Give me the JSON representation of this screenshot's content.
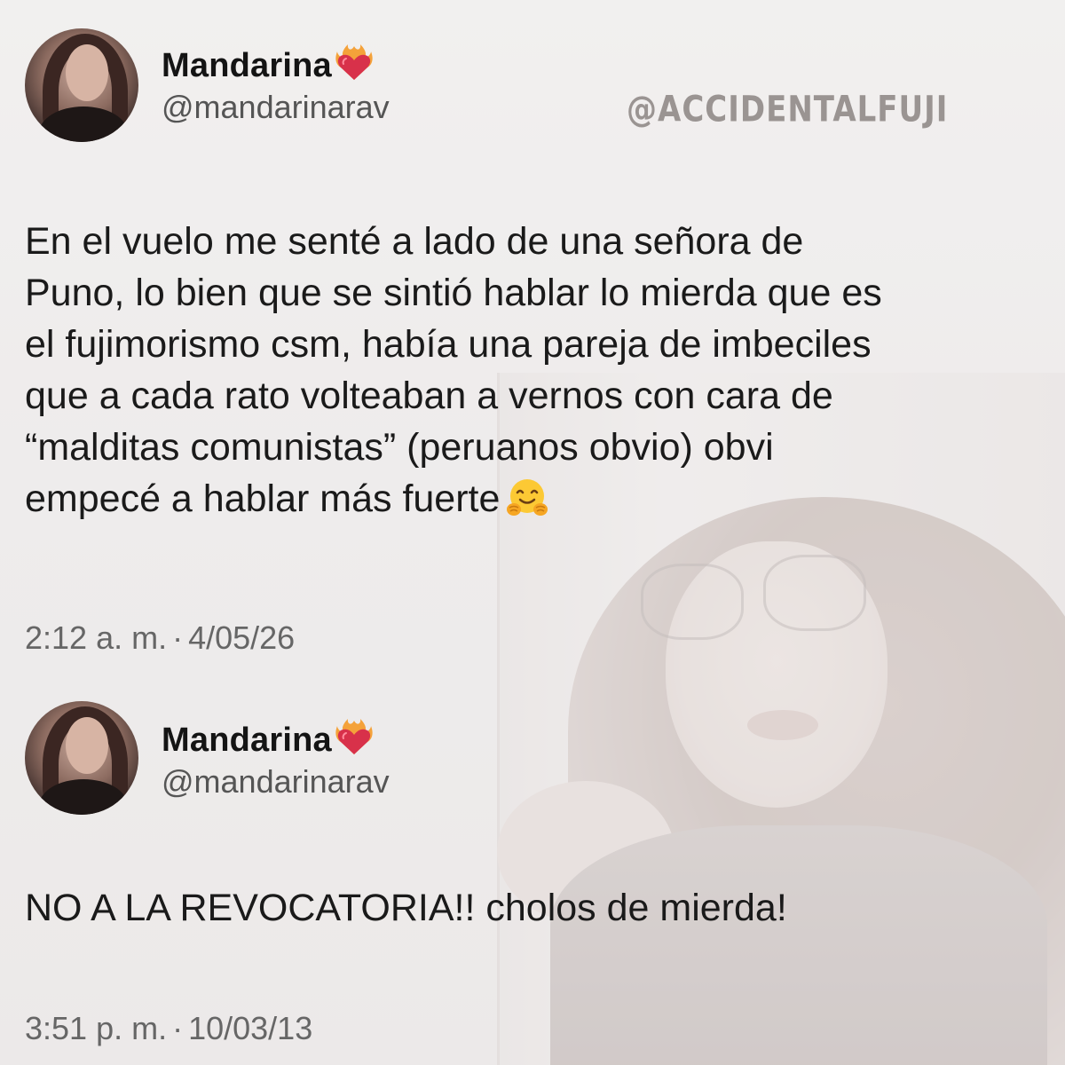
{
  "watermark": "@ACCIDENTALFUJI",
  "tweets": [
    {
      "author": {
        "display_name": "Mandarina",
        "name_emoji": "heart-on-fire-emoji",
        "handle": "@mandarinarav"
      },
      "text_lines": [
        "En el vuelo me senté a lado de una señora de",
        "Puno, lo bien que se sintió hablar lo mierda que es",
        "el fujimorismo csm, había una pareja de imbeciles",
        "que a cada rato volteaban a vernos con cara de",
        "“malditas comunistas” (peruanos obvio) obvi",
        "empecé a hablar más fuerte"
      ],
      "trailing_emoji": "hugging-face-emoji",
      "time": "2:12 a. m.",
      "separator": "·",
      "date": "4/05/26"
    },
    {
      "author": {
        "display_name": "Mandarina",
        "name_emoji": "heart-on-fire-emoji",
        "handle": "@mandarinarav"
      },
      "text_lines": [
        "NO A LA REVOCATORIA!! cholos de mierda!"
      ],
      "time": "3:51 p. m.",
      "separator": "·",
      "date": "10/03/13"
    }
  ],
  "colors": {
    "text": "#1a1a1a",
    "secondary": "#666666",
    "watermark": "#9a9492",
    "heart": "#d8314a",
    "flame": "#f4a23a"
  }
}
